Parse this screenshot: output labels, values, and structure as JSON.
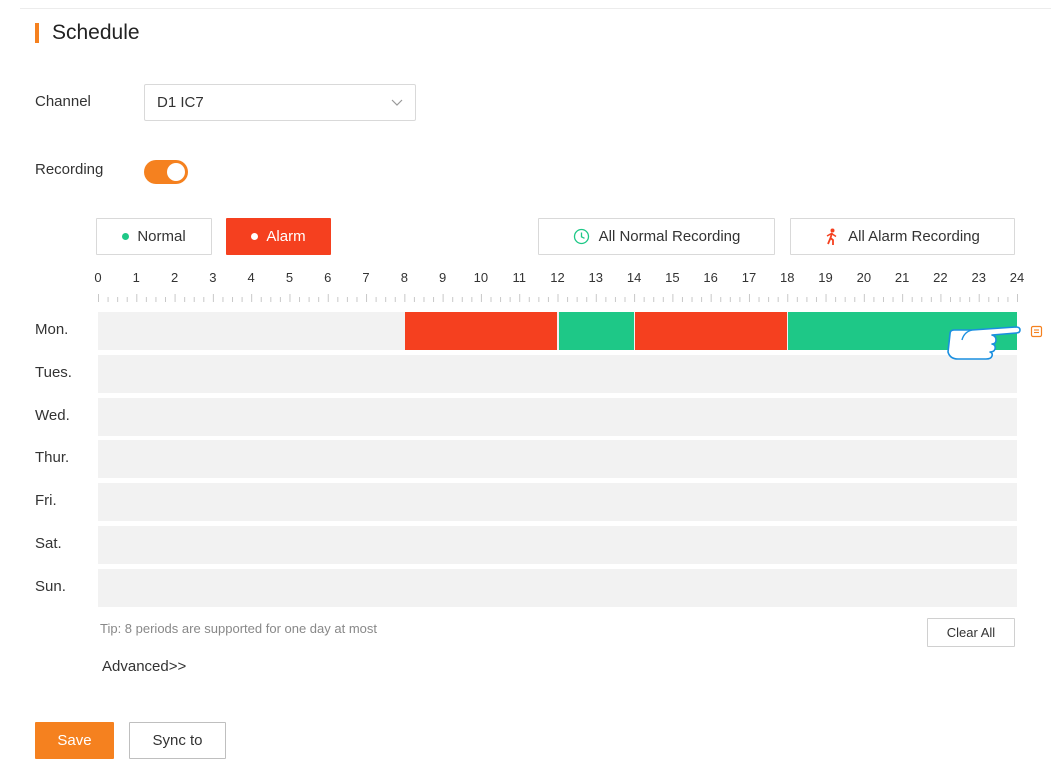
{
  "page": {
    "title": "Schedule"
  },
  "channel": {
    "label": "Channel",
    "value": "D1 IC7"
  },
  "recording": {
    "label": "Recording",
    "enabled": true
  },
  "modes": {
    "normal_label": "Normal",
    "alarm_label": "Alarm",
    "selected": "Alarm",
    "all_normal_label": "All Normal Recording",
    "all_alarm_label": "All Alarm Recording"
  },
  "colors": {
    "accent": "#f5811f",
    "alarm": "#f5401f",
    "normal": "#1ec887",
    "empty": "#f2f2f2"
  },
  "timeline": {
    "hours": [
      "0",
      "1",
      "2",
      "3",
      "4",
      "5",
      "6",
      "7",
      "8",
      "9",
      "10",
      "11",
      "12",
      "13",
      "14",
      "15",
      "16",
      "17",
      "18",
      "19",
      "20",
      "21",
      "22",
      "23",
      "24"
    ]
  },
  "schedule": {
    "days": [
      {
        "label": "Mon.",
        "periods": [
          {
            "start": 8,
            "end": 12,
            "type": "alarm"
          },
          {
            "start": 12,
            "end": 14,
            "type": "normal"
          },
          {
            "start": 14,
            "end": 18,
            "type": "alarm"
          },
          {
            "start": 18,
            "end": 24,
            "type": "normal"
          }
        ]
      },
      {
        "label": "Tues.",
        "periods": []
      },
      {
        "label": "Wed.",
        "periods": []
      },
      {
        "label": "Thur.",
        "periods": []
      },
      {
        "label": "Fri.",
        "periods": []
      },
      {
        "label": "Sat.",
        "periods": []
      },
      {
        "label": "Sun.",
        "periods": []
      }
    ],
    "copy_icon": "copy-icon",
    "cursor_icon": "pointing-hand-icon"
  },
  "tip": "Tip: 8 periods are supported for one day at most",
  "actions": {
    "clear_all_label": "Clear All",
    "advanced_label": "Advanced>>",
    "save_label": "Save",
    "sync_label": "Sync to"
  }
}
